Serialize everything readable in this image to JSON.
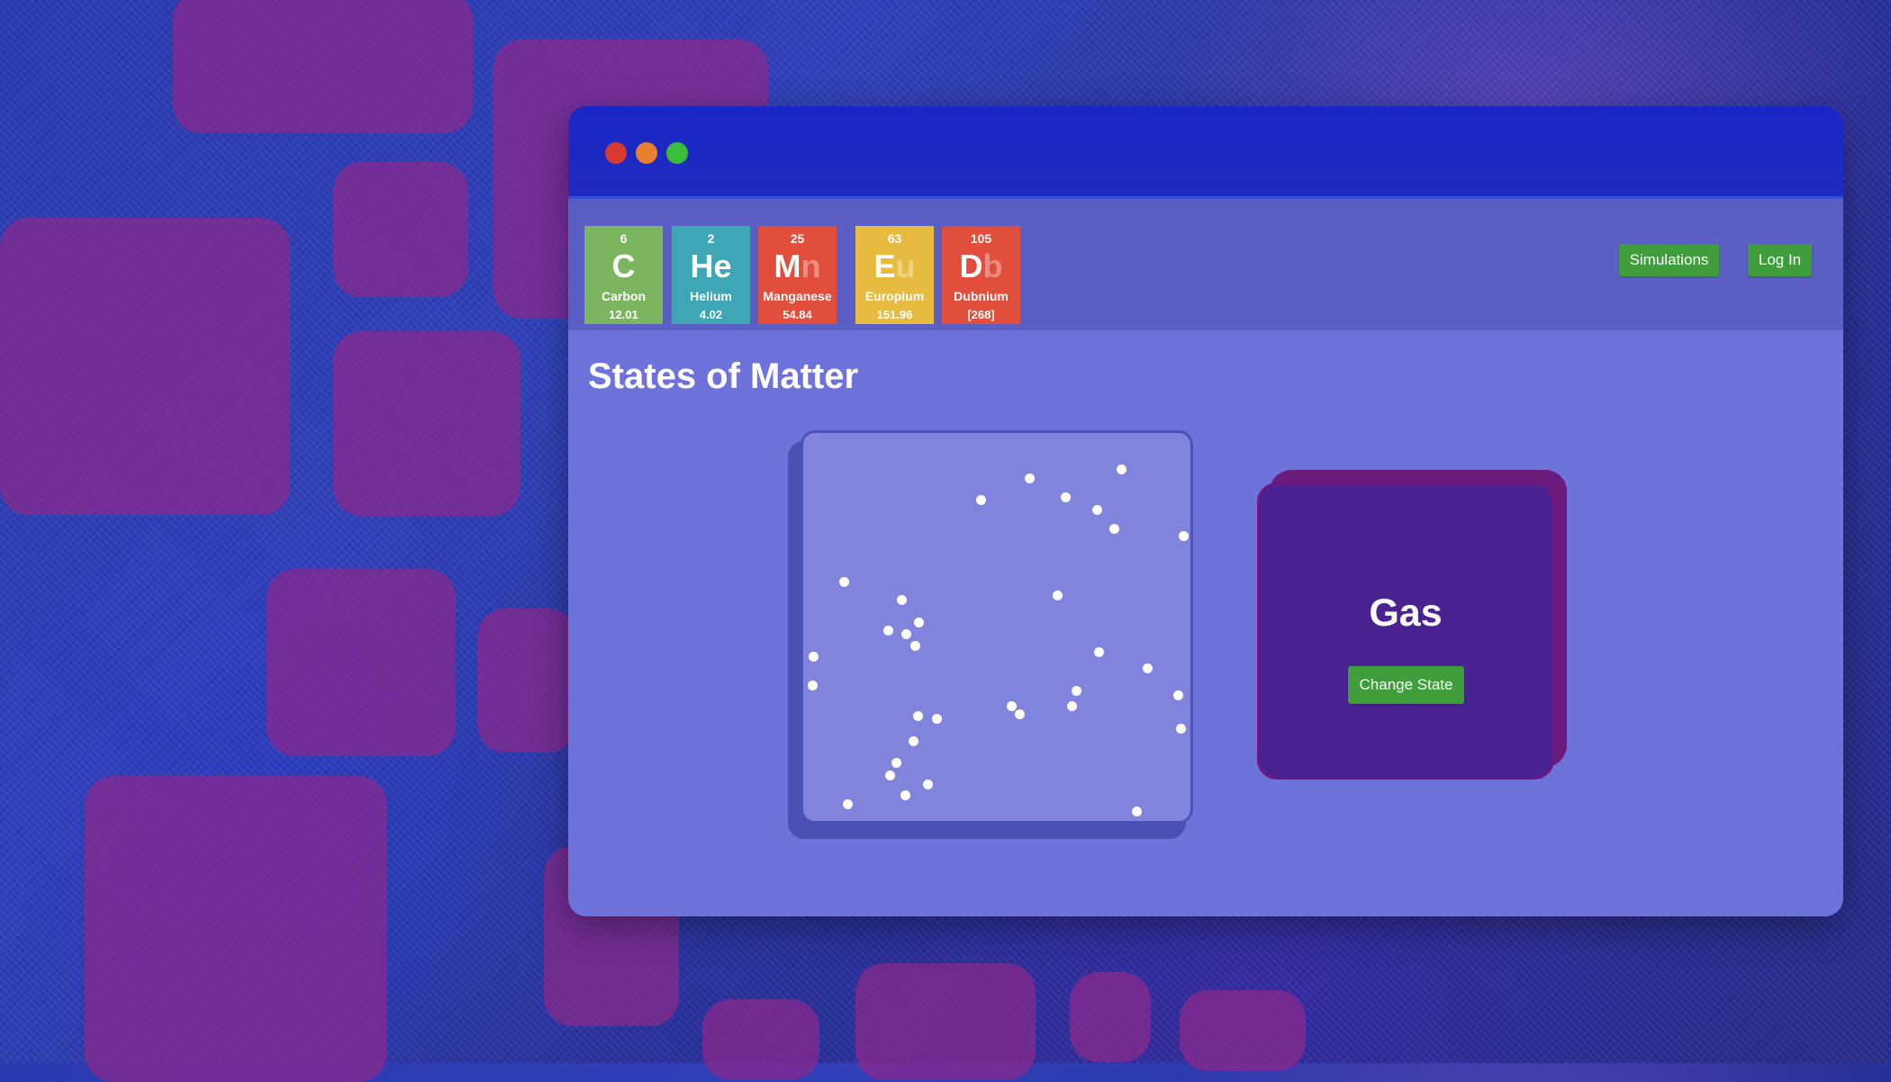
{
  "window": {
    "controls": [
      "close",
      "minimize",
      "maximize"
    ]
  },
  "elements": [
    {
      "number": "6",
      "symbol_main": "C",
      "symbol_faint": "",
      "name": "Carbon",
      "mass": "12.01",
      "color": "#7cb55f"
    },
    {
      "number": "2",
      "symbol_main": "He",
      "symbol_faint": "",
      "name": "Helium",
      "mass": "4.02",
      "color": "#3ea6b4"
    },
    {
      "number": "25",
      "symbol_main": "M",
      "symbol_faint": "n",
      "name": "Manganese",
      "mass": "54.84",
      "color": "#e24e3c"
    },
    {
      "number": "63",
      "symbol_main": "E",
      "symbol_faint": "u",
      "name": "Europium",
      "mass": "151.96",
      "color": "#e6bb3f"
    },
    {
      "number": "105",
      "symbol_main": "D",
      "symbol_faint": "b",
      "name": "Dubnium",
      "mass": "[268]",
      "color": "#e24e3c"
    }
  ],
  "nav": {
    "simulations_label": "Simulations",
    "login_label": "Log In"
  },
  "main": {
    "title": "States of Matter",
    "state_label": "Gas",
    "change_state_label": "Change State"
  },
  "colors": {
    "accent_button": "#3f9e3b",
    "titlebar": "#1a27c8",
    "content_bg": "#6e72db",
    "state_panel": "#4a2292"
  }
}
